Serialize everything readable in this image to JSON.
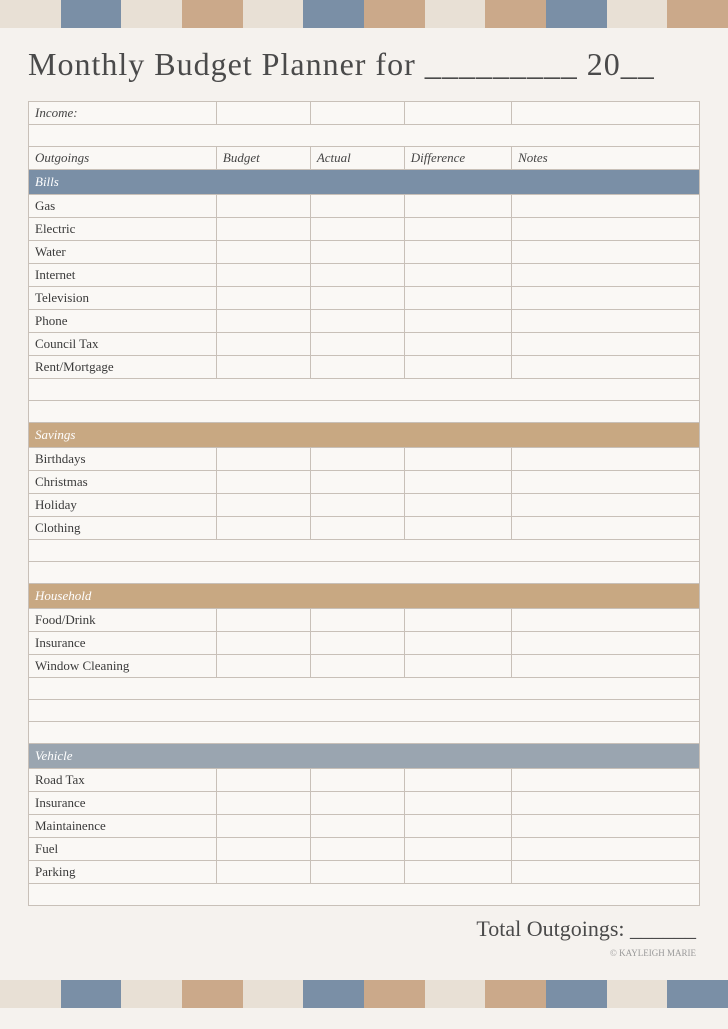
{
  "page": {
    "title": "Monthly Budget Planner for _________ 20__",
    "total_label": "Total Outgoings: ______",
    "copyright": "© KAYLEIGH MARIE"
  },
  "deco_colors": [
    "seg-1",
    "seg-2",
    "seg-3",
    "seg-4",
    "seg-5",
    "seg-6",
    "seg-7",
    "seg-8",
    "seg-9",
    "seg-10",
    "seg-11",
    "seg-12"
  ],
  "columns": {
    "label": "",
    "outgoings": "Outgoings",
    "budget": "Budget",
    "actual": "Actual",
    "difference": "Difference",
    "notes": "Notes"
  },
  "sections": {
    "bills": "Bills",
    "savings": "Savings",
    "household": "Household",
    "vehicle": "Vehicle"
  },
  "rows": {
    "income": "Income:",
    "bills": [
      "Gas",
      "Electric",
      "Water",
      "Internet",
      "Television",
      "Phone",
      "Council Tax",
      "Rent/Mortgage"
    ],
    "savings": [
      "Birthdays",
      "Christmas",
      "Holiday",
      "Clothing"
    ],
    "household": [
      "Food/Drink",
      "Insurance",
      "Window Cleaning"
    ],
    "vehicle": [
      "Road Tax",
      "Insurance",
      "Maintainence",
      "Fuel",
      "Parking"
    ]
  }
}
